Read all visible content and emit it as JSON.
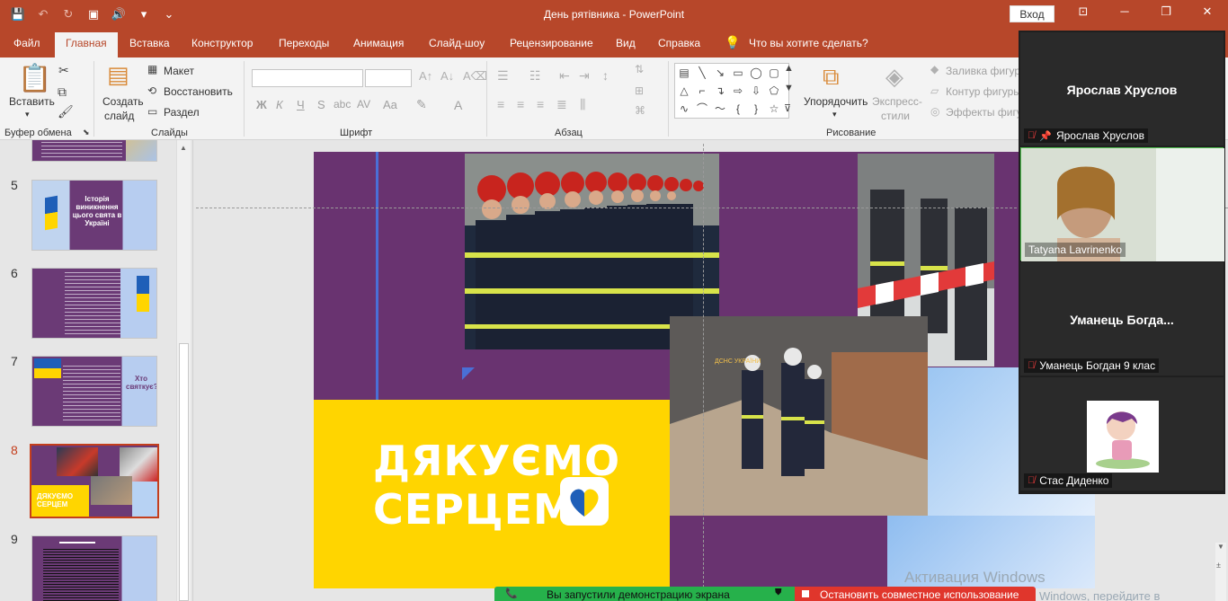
{
  "window": {
    "title": "День рятівника  -  PowerPoint",
    "login_label": "Вход",
    "minimize_glyph": "─",
    "maximize_glyph": "❐",
    "close_glyph": "✕",
    "ribbon_display_glyph": "⊡"
  },
  "tabs": [
    "Файл",
    "Главная",
    "Вставка",
    "Конструктор",
    "Переходы",
    "Анимация",
    "Слайд-шоу",
    "Рецензирование",
    "Вид",
    "Справка"
  ],
  "tell_me": "Что вы хотите сделать?",
  "ribbon": {
    "clipboard": {
      "paste": "Вставить",
      "label": "Буфер обмена"
    },
    "slides": {
      "new_slide_1": "Создать",
      "new_slide_2": "слайд",
      "layout": "Макет",
      "reset": "Восстановить",
      "section": "Раздел",
      "label": "Слайды"
    },
    "font": {
      "bold": "Ж",
      "italic": "К",
      "underline": "Ч",
      "strike": "S",
      "shadow": "abc",
      "spacing": "AV",
      "case": "Aa",
      "color": "A",
      "label": "Шрифт"
    },
    "paragraph": {
      "label": "Абзац"
    },
    "drawing": {
      "arrange_1": "Упорядочить",
      "styles_1": "Экспресс-",
      "styles_2": "стили",
      "fill": "Заливка фигуры",
      "outline": "Контур фигуры",
      "effects": "Эффекты фигур",
      "label": "Рисование"
    }
  },
  "thumbnails": [
    {
      "num": "5",
      "title": "Історія виникнення цього свята в Україні"
    },
    {
      "num": "6"
    },
    {
      "num": "7",
      "title": "Хто святкує?"
    },
    {
      "num": "8",
      "title": "ДЯКУЄМО СЕРЦЕМ",
      "active": true
    },
    {
      "num": "9"
    }
  ],
  "slide": {
    "headline_1": "ДЯКУЄМО",
    "headline_2": "СЕРЦЕМ",
    "banner_text": "ДСНС УКРАЇНИ"
  },
  "panel": {
    "tiles": [
      {
        "name": "Ярослав Хруслов",
        "label": "Ярослав Хруслов",
        "pinned": true
      },
      {
        "label": "Tatyana Lavrinenko",
        "video": true
      },
      {
        "name": "Уманець  Богда...",
        "label": "Уманець Богдан 9 клас"
      },
      {
        "label": "Стас Диденко",
        "avatar": true
      }
    ]
  },
  "share": {
    "active_text": "Вы запустили демонстрацию экрана",
    "stop_text": "Остановить совместное использование"
  },
  "watermark": {
    "line1": "Активация Windows",
    "line2": "Windows, перейдите в"
  },
  "colors": {
    "accent": "#b7472a",
    "slide_purple": "#693370",
    "slide_yellow": "#ffd500",
    "share_green": "#26b14b",
    "stop_red": "#e0362c"
  }
}
